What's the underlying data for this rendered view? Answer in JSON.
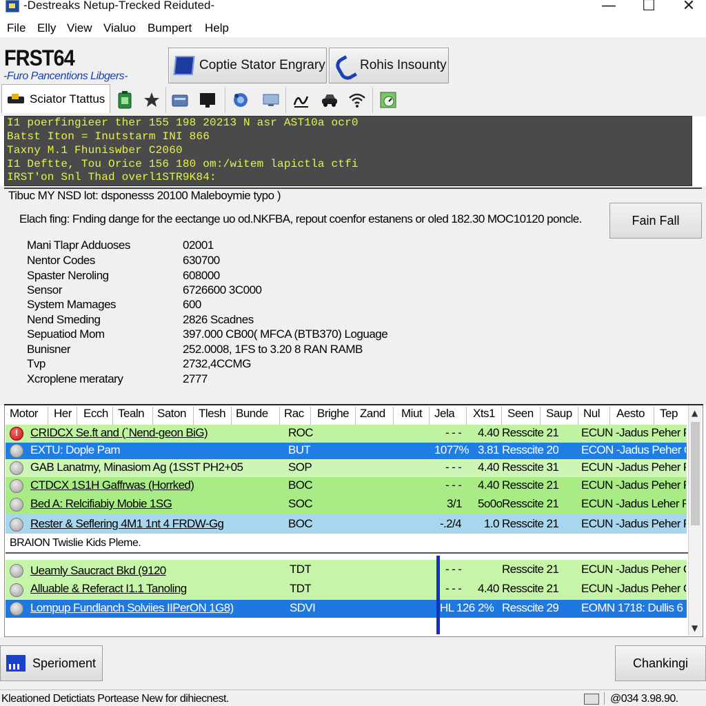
{
  "window": {
    "title": "-Destreaks Netup-Trecked Reiduted-",
    "minimize_glyph": "—",
    "maximize_glyph": "☐",
    "close_glyph": "✕"
  },
  "menu": [
    "File",
    "Elly",
    "View",
    "Vialuo",
    "Bumpert",
    "Help"
  ],
  "brand": {
    "name": "FRST64",
    "subtitle": "-Furo Pancentions Libgers-"
  },
  "buttons": {
    "encrypt": "Coptie Stator Engrary",
    "phone": "Rohis Insounty",
    "fail": "Fain Fall",
    "sperioment": "Sperioment",
    "chanking": "Chankingi"
  },
  "tab": {
    "label": "Sciator Ttattus"
  },
  "toolbar_icons": [
    "battery-icon",
    "star-icon",
    "drive-icon",
    "terminal-icon",
    "network-icon",
    "monitor-icon",
    "signature-icon",
    "car-icon",
    "wifi-icon",
    "gauge-icon"
  ],
  "terminal": {
    "lines": [
      "I1 poerfingieer ther 155 198 20213 N asr AST10a ocr0",
      "Batst Iton = Inutstarm INI 866",
      "Taxny M.1 Fhuniswber C2060",
      "I1 Deftte, Tou Orice 156 180 om:/witem lapictla ctfi",
      "IRST'on Snl Thad overl1STR9K84:"
    ]
  },
  "info": {
    "header": "Tibuc MY NSD lot: dsponesss 20100 Maleboymie typo )",
    "description": "Elach fing: Fnding dange for the eectange uo od.NKFBA, repout coenfor estanens or oled 182.30 MOC10120 poncle.",
    "properties": [
      {
        "label": "Mani Tlapr Adduoses",
        "value": "02001"
      },
      {
        "label": "Nentor Codes",
        "value": "630700"
      },
      {
        "label": "Spaster Neroling",
        "value": "608000"
      },
      {
        "label": "Sensor",
        "value": "6726600 3C000"
      },
      {
        "label": "System Mamages",
        "value": "600"
      },
      {
        "label": "Nend Smeding",
        "value": "2826 Scadnes"
      },
      {
        "label": "Sepuatiod Mom",
        "value": "397.000 CB00( MFCA (BTB370) Loguage"
      },
      {
        "label": "Bunisner",
        "value": "252.0008, 1FS to 3.20 8 RAN RAMB"
      },
      {
        "label": "Tvp",
        "value": "2732,4CCMG"
      },
      {
        "label": "Xcroplene meratary",
        "value": "2777"
      }
    ]
  },
  "grid": {
    "columns": [
      "Motor",
      "Her",
      "Ecch",
      "Tealn",
      "Saton",
      "Tlesh",
      "Bunde",
      "Rac",
      "Brighe",
      "Zand",
      "Miut",
      "Jela",
      "Xts1",
      "Seen",
      "Saup",
      "Nul",
      "Aesto",
      "Tep"
    ],
    "rows_top": [
      {
        "status": "error",
        "name": "CRIDCX Se.ft and (`Nend-geon BiG)",
        "code": "ROC",
        "val": "- - -",
        "size": "4.40",
        "result": "Resscite 21",
        "owner": "ECUN -Jadus Peher P",
        "color": "#bff3a0",
        "text_color": "#000000"
      },
      {
        "status": "info",
        "name": "EXTU: Dople Pam",
        "code": "BUT",
        "val": "1077%",
        "size": "3.81",
        "result": "Resscite 20",
        "owner": "ECON -Jadus Peher O",
        "color": "#1e7ee6",
        "text_color": "#ffffff"
      },
      {
        "status": "info",
        "name": "GAB Lanatmy, Minasiom Ag (1SST PH2+05",
        "code": "SOP",
        "val": "- - -",
        "size": "4.40",
        "result": "Resscite 31",
        "owner": "ECUN -Jadus Peher P",
        "color": "#cdf5b5",
        "text_color": "#000000"
      },
      {
        "status": "info",
        "name": "CTDCX 1S1H Gaffrwas (Horrked)",
        "code": "BOC",
        "val": "- - -",
        "size": "4.40",
        "result": "Resscite 21",
        "owner": "ECUN -Jadus Peher R",
        "color": "#a9ec86",
        "text_color": "#000000"
      },
      {
        "status": "info",
        "name": "Bed A: Relcifiabiy Mobie 1SG",
        "code": "SOC",
        "val": "3/1",
        "size": "5o0o",
        "result": "Resscite 21",
        "owner": "ECUN -Jadus Leher R",
        "color": "#a9ec86",
        "text_color": "#000000"
      },
      {
        "status": "info",
        "name": "Rester & Seflering 4M1 1nt 4 FRDW-Gg",
        "code": "BOC",
        "val": "-.2/4",
        "size": "1.0",
        "result": "Resscite 21",
        "owner": "ECUN -Jadus Peher P",
        "color": "#a9d6ef",
        "text_color": "#000000"
      }
    ],
    "subheader": "BRAION Twislie Kids Pleme.",
    "rows_bottom": [
      {
        "status": "info",
        "name": "Ueamly Saucract Bkd (9120",
        "code": "TDT",
        "val": "- - -",
        "size": "",
        "result": "Resscite 21",
        "owner": "ECUN -Jadus Peher C",
        "color": "#c6f4a8",
        "text_color": "#000000"
      },
      {
        "status": "info",
        "name": "Alluable & Referact I1.1 Tanoling",
        "code": "TDT",
        "val": "- - -",
        "size": "4.40",
        "result": "Resscite 21",
        "owner": "ECUN -Jadus Peher C",
        "color": "#c6f4a8",
        "text_color": "#000000"
      },
      {
        "status": "info",
        "name": "Lompup Fundlanch Solviies  IIPerON 1G8)",
        "code": "SDVI",
        "val": "HL 126",
        "size": "2%",
        "result": "Resscite 29",
        "owner": "EOMN 1718: Dullis 6",
        "color": "#1f78e0",
        "text_color": "#ffffff"
      }
    ]
  },
  "status": {
    "left": "Kleationed Detictiats Portease New for dihiecnest.",
    "right": "@034 3.98.90."
  }
}
